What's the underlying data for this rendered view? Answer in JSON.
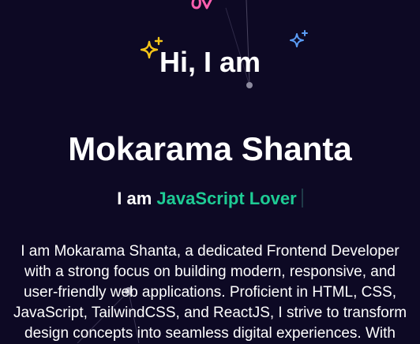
{
  "hero": {
    "greeting": "Hi, I am",
    "name": "Mokarama Shanta",
    "tagline_prefix": "I am ",
    "tagline_role": "JavaScript Lover",
    "bio": "I am Mokarama Shanta, a dedicated Frontend Developer with a strong focus on building modern, responsive, and user-friendly web applications. Proficient in HTML, CSS, JavaScript, TailwindCSS, and ReactJS, I strive to transform design concepts into seamless digital experiences. With"
  },
  "icons": {
    "sparkle_left": "sparkle-icon",
    "sparkle_right": "sparkle-icon",
    "partial_top": "partial-glyph-icon"
  },
  "colors": {
    "background": "#0d0924",
    "accent": "#1ecb94",
    "sparkle_yellow": "#f5c518",
    "sparkle_blue": "#5b9cf5",
    "top_pink": "#ff5fb0"
  }
}
